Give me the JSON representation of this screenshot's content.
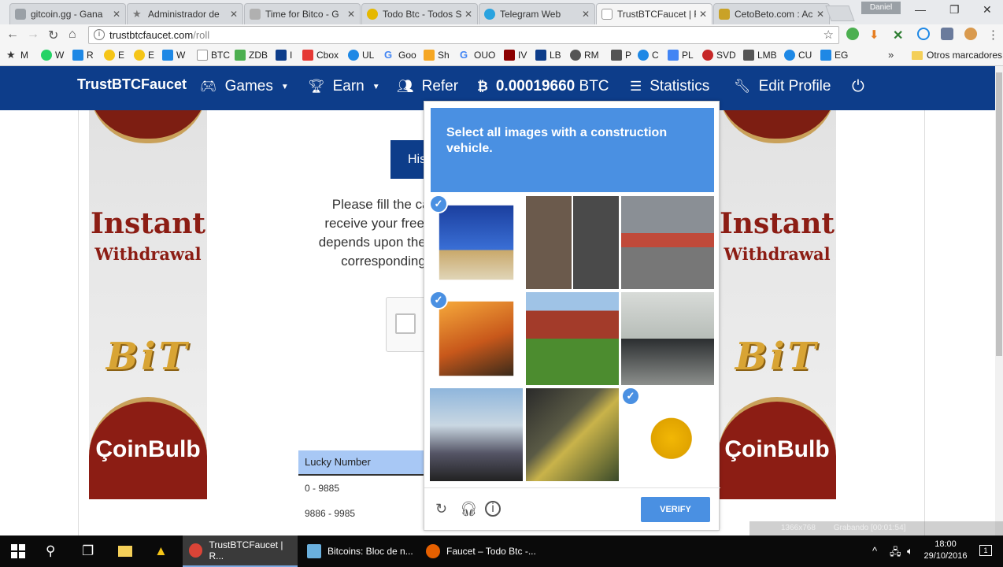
{
  "browser": {
    "tabs": [
      {
        "title": "gitcoin.gg - Gana",
        "favicon_color": "#9aa0a6"
      },
      {
        "title": "Administrador de",
        "favicon_color": "#777777"
      },
      {
        "title": "Time for Bitco - G",
        "favicon_color": "#b0b0b0"
      },
      {
        "title": "Todo Btc - Todos S",
        "favicon_color": "#e5b800"
      },
      {
        "title": "Telegram Web",
        "favicon_color": "#2aa3df"
      },
      {
        "title": "TrustBTCFaucet | R",
        "favicon_color": "#999999"
      },
      {
        "title": "CetoBeto.com : Ac",
        "favicon_color": "#c9a227"
      }
    ],
    "user_badge": "Daniel",
    "address": {
      "host": "trustbtcfaucet.com",
      "path": "/roll"
    },
    "bookmarks": [
      {
        "label": "M",
        "color": "#333333"
      },
      {
        "label": "W",
        "color": "#25d366"
      },
      {
        "label": "R",
        "color": "#1e88e5"
      },
      {
        "label": "E",
        "color": "#f5c518"
      },
      {
        "label": "E",
        "color": "#f5c518"
      },
      {
        "label": "W",
        "color": "#1e88e5"
      },
      {
        "label": "BTC",
        "color": "#bbbbbb"
      },
      {
        "label": "ZDB",
        "color": "#4caf50"
      },
      {
        "label": "I",
        "color": "#0d3d8a"
      },
      {
        "label": "Cbox",
        "color": "#e53935"
      },
      {
        "label": "UL",
        "color": "#1e88e5"
      },
      {
        "label": "Goo",
        "color": "#4285f4"
      },
      {
        "label": "Sh",
        "color": "#f5a623"
      },
      {
        "label": "OUO",
        "color": "#4285f4"
      },
      {
        "label": "IV",
        "color": "#8b0000"
      },
      {
        "label": "LB",
        "color": "#0d3d8a"
      },
      {
        "label": "RM",
        "color": "#555555"
      },
      {
        "label": "P",
        "color": "#555555"
      },
      {
        "label": "C",
        "color": "#1e88e5"
      },
      {
        "label": "PL",
        "color": "#4285f4"
      },
      {
        "label": "SVD",
        "color": "#c62828"
      },
      {
        "label": "LMB",
        "color": "#555555"
      },
      {
        "label": "CU",
        "color": "#1e88e5"
      },
      {
        "label": "EG",
        "color": "#1e88e5"
      }
    ],
    "bookmarks_more": "»",
    "other_bookmarks": "Otros marcadores"
  },
  "site": {
    "brand": "TrustBTCFaucet",
    "nav": {
      "games": "Games",
      "earn": "Earn",
      "refer": "Refer",
      "balance_amount": "0.00019660",
      "balance_unit": "BTC",
      "statistics": "Statistics",
      "edit_profile": "Edit Profile"
    },
    "history_button": "His",
    "instructions": [
      "Please fill the cap",
      "receive your free B",
      "depends upon the n",
      "corresponding p"
    ],
    "lucky_table": {
      "header": "Lucky Number",
      "rows": [
        "0 - 9885",
        "9886 - 9985"
      ]
    },
    "banner": {
      "line1": "Instant",
      "line2": "Withdrawal",
      "line3": "BiT",
      "line4": "ÇoinBulb"
    }
  },
  "captcha": {
    "prompt_prefix": "Select all images with a",
    "prompt_target": "construction vehicle.",
    "tiles": [
      {
        "subject": "crane",
        "selected": true
      },
      {
        "subject": "car-parts",
        "selected": false
      },
      {
        "subject": "storefront",
        "selected": false
      },
      {
        "subject": "excavator",
        "selected": true
      },
      {
        "subject": "tractor",
        "selected": false
      },
      {
        "subject": "car-showroom",
        "selected": false
      },
      {
        "subject": "building",
        "selected": false
      },
      {
        "subject": "flowers",
        "selected": false
      },
      {
        "subject": "backhoe",
        "selected": true
      }
    ],
    "verify_label": "VERIFY",
    "selected_color": "#4a90e2"
  },
  "recording_overlay": {
    "resolution": "1366x768",
    "status": "Grabando [00:01:54]"
  },
  "taskbar": {
    "apps": [
      {
        "label": "TrustBTCFaucet | R...",
        "color": "#db4437"
      },
      {
        "label": "Bitcoins: Bloc de n...",
        "color": "#6ab0de"
      },
      {
        "label": "Faucet – Todo Btc -...",
        "color": "#e66000"
      }
    ],
    "time": "18:00",
    "date": "29/10/2016",
    "notification_count": "1"
  }
}
